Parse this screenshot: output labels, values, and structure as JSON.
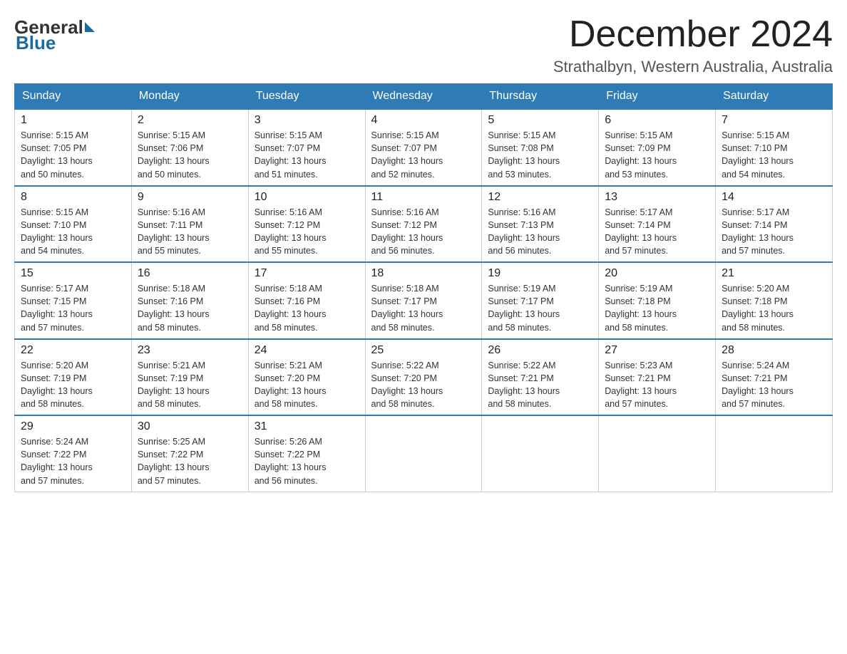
{
  "header": {
    "title": "December 2024",
    "location": "Strathalbyn, Western Australia, Australia",
    "logo_line1": "General",
    "logo_line2": "Blue"
  },
  "weekdays": [
    "Sunday",
    "Monday",
    "Tuesday",
    "Wednesday",
    "Thursday",
    "Friday",
    "Saturday"
  ],
  "weeks": [
    [
      {
        "day": "1",
        "sunrise": "5:15 AM",
        "sunset": "7:05 PM",
        "daylight": "13 hours and 50 minutes."
      },
      {
        "day": "2",
        "sunrise": "5:15 AM",
        "sunset": "7:06 PM",
        "daylight": "13 hours and 50 minutes."
      },
      {
        "day": "3",
        "sunrise": "5:15 AM",
        "sunset": "7:07 PM",
        "daylight": "13 hours and 51 minutes."
      },
      {
        "day": "4",
        "sunrise": "5:15 AM",
        "sunset": "7:07 PM",
        "daylight": "13 hours and 52 minutes."
      },
      {
        "day": "5",
        "sunrise": "5:15 AM",
        "sunset": "7:08 PM",
        "daylight": "13 hours and 53 minutes."
      },
      {
        "day": "6",
        "sunrise": "5:15 AM",
        "sunset": "7:09 PM",
        "daylight": "13 hours and 53 minutes."
      },
      {
        "day": "7",
        "sunrise": "5:15 AM",
        "sunset": "7:10 PM",
        "daylight": "13 hours and 54 minutes."
      }
    ],
    [
      {
        "day": "8",
        "sunrise": "5:15 AM",
        "sunset": "7:10 PM",
        "daylight": "13 hours and 54 minutes."
      },
      {
        "day": "9",
        "sunrise": "5:16 AM",
        "sunset": "7:11 PM",
        "daylight": "13 hours and 55 minutes."
      },
      {
        "day": "10",
        "sunrise": "5:16 AM",
        "sunset": "7:12 PM",
        "daylight": "13 hours and 55 minutes."
      },
      {
        "day": "11",
        "sunrise": "5:16 AM",
        "sunset": "7:12 PM",
        "daylight": "13 hours and 56 minutes."
      },
      {
        "day": "12",
        "sunrise": "5:16 AM",
        "sunset": "7:13 PM",
        "daylight": "13 hours and 56 minutes."
      },
      {
        "day": "13",
        "sunrise": "5:17 AM",
        "sunset": "7:14 PM",
        "daylight": "13 hours and 57 minutes."
      },
      {
        "day": "14",
        "sunrise": "5:17 AM",
        "sunset": "7:14 PM",
        "daylight": "13 hours and 57 minutes."
      }
    ],
    [
      {
        "day": "15",
        "sunrise": "5:17 AM",
        "sunset": "7:15 PM",
        "daylight": "13 hours and 57 minutes."
      },
      {
        "day": "16",
        "sunrise": "5:18 AM",
        "sunset": "7:16 PM",
        "daylight": "13 hours and 58 minutes."
      },
      {
        "day": "17",
        "sunrise": "5:18 AM",
        "sunset": "7:16 PM",
        "daylight": "13 hours and 58 minutes."
      },
      {
        "day": "18",
        "sunrise": "5:18 AM",
        "sunset": "7:17 PM",
        "daylight": "13 hours and 58 minutes."
      },
      {
        "day": "19",
        "sunrise": "5:19 AM",
        "sunset": "7:17 PM",
        "daylight": "13 hours and 58 minutes."
      },
      {
        "day": "20",
        "sunrise": "5:19 AM",
        "sunset": "7:18 PM",
        "daylight": "13 hours and 58 minutes."
      },
      {
        "day": "21",
        "sunrise": "5:20 AM",
        "sunset": "7:18 PM",
        "daylight": "13 hours and 58 minutes."
      }
    ],
    [
      {
        "day": "22",
        "sunrise": "5:20 AM",
        "sunset": "7:19 PM",
        "daylight": "13 hours and 58 minutes."
      },
      {
        "day": "23",
        "sunrise": "5:21 AM",
        "sunset": "7:19 PM",
        "daylight": "13 hours and 58 minutes."
      },
      {
        "day": "24",
        "sunrise": "5:21 AM",
        "sunset": "7:20 PM",
        "daylight": "13 hours and 58 minutes."
      },
      {
        "day": "25",
        "sunrise": "5:22 AM",
        "sunset": "7:20 PM",
        "daylight": "13 hours and 58 minutes."
      },
      {
        "day": "26",
        "sunrise": "5:22 AM",
        "sunset": "7:21 PM",
        "daylight": "13 hours and 58 minutes."
      },
      {
        "day": "27",
        "sunrise": "5:23 AM",
        "sunset": "7:21 PM",
        "daylight": "13 hours and 57 minutes."
      },
      {
        "day": "28",
        "sunrise": "5:24 AM",
        "sunset": "7:21 PM",
        "daylight": "13 hours and 57 minutes."
      }
    ],
    [
      {
        "day": "29",
        "sunrise": "5:24 AM",
        "sunset": "7:22 PM",
        "daylight": "13 hours and 57 minutes."
      },
      {
        "day": "30",
        "sunrise": "5:25 AM",
        "sunset": "7:22 PM",
        "daylight": "13 hours and 57 minutes."
      },
      {
        "day": "31",
        "sunrise": "5:26 AM",
        "sunset": "7:22 PM",
        "daylight": "13 hours and 56 minutes."
      },
      null,
      null,
      null,
      null
    ]
  ],
  "labels": {
    "sunrise": "Sunrise:",
    "sunset": "Sunset:",
    "daylight": "Daylight:"
  }
}
